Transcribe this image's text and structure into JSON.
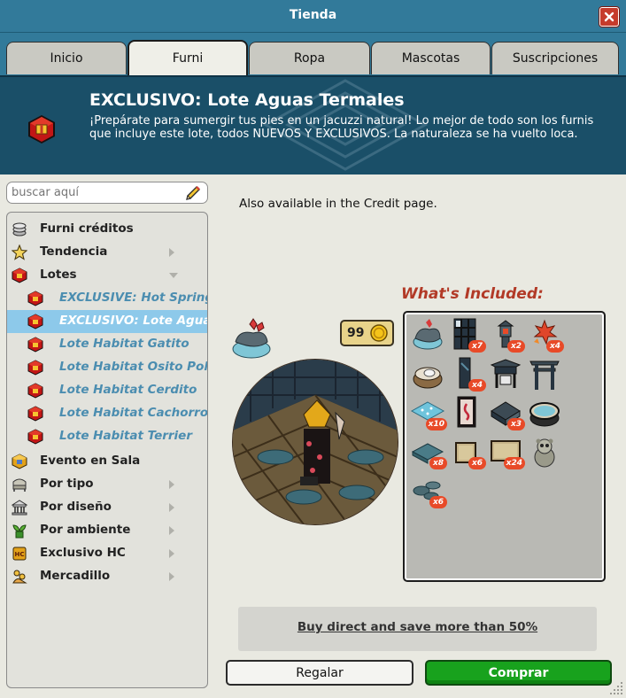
{
  "window": {
    "title": "Tienda"
  },
  "tabs": [
    {
      "label": "Inicio",
      "active": false
    },
    {
      "label": "Furni",
      "active": true
    },
    {
      "label": "Ropa",
      "active": false
    },
    {
      "label": "Mascotas",
      "active": false
    },
    {
      "label": "Suscripciones",
      "active": false
    }
  ],
  "banner": {
    "title": "EXCLUSIVO: Lote Aguas Termales",
    "description": "¡Prepárate para sumergir tus pies en un jacuzzi natural! Lo mejor de todo son los furnis que incluye este lote, todos NUEVOS Y EXCLUSIVOS. La naturaleza se ha vuelto loca."
  },
  "search": {
    "placeholder": "buscar aquí",
    "value": ""
  },
  "sidebar": {
    "items": [
      {
        "label": "Furni créditos",
        "icon": "coins-icon"
      },
      {
        "label": "Tendencia",
        "icon": "star-icon",
        "arrow": "right"
      },
      {
        "label": "Lotes",
        "icon": "bundle-cube-icon",
        "arrow": "down"
      },
      {
        "label": "EXCLUSIVE: Hot Spring",
        "icon": "bundle-cube-icon",
        "sub": true
      },
      {
        "label": "EXCLUSIVO: Lote Aguas",
        "icon": "bundle-cube-icon",
        "sub": true,
        "selected": true
      },
      {
        "label": "Lote Habitat Gatito",
        "icon": "bundle-cube-icon",
        "sub": true
      },
      {
        "label": "Lote Habitat Osito Pola",
        "icon": "bundle-cube-icon",
        "sub": true
      },
      {
        "label": "Lote Habitat Cerdito",
        "icon": "bundle-cube-icon",
        "sub": true
      },
      {
        "label": "Lote Habitat Cachorro",
        "icon": "bundle-cube-icon",
        "sub": true
      },
      {
        "label": "Lote Habitat Terrier",
        "icon": "bundle-cube-icon",
        "sub": true
      },
      {
        "label": "Evento en Sala",
        "icon": "event-cube-icon"
      },
      {
        "label": "Por tipo",
        "icon": "chair-icon",
        "arrow": "right"
      },
      {
        "label": "Por diseño",
        "icon": "building-icon",
        "arrow": "right"
      },
      {
        "label": "Por ambiente",
        "icon": "plant-icon",
        "arrow": "right"
      },
      {
        "label": "Exclusivo HC",
        "icon": "hc-icon",
        "arrow": "right"
      },
      {
        "label": "Mercadillo",
        "icon": "marketplace-icon",
        "arrow": "right"
      }
    ]
  },
  "product": {
    "notice": "Also available in the Credit page.",
    "price": "99",
    "included_title": "What's Included:",
    "included": [
      {
        "icon": "rock-pool-icon",
        "qty": ""
      },
      {
        "icon": "shoji-window-icon",
        "qty": "x7"
      },
      {
        "icon": "stone-lantern-icon",
        "qty": "x2"
      },
      {
        "icon": "maple-leaves-icon",
        "qty": "x4"
      },
      {
        "icon": "hot-tub-icon",
        "qty": ""
      },
      {
        "icon": "wall-panel-icon",
        "qty": "x4"
      },
      {
        "icon": "shrine-gate-icon",
        "qty": ""
      },
      {
        "icon": "torii-icon",
        "qty": ""
      },
      {
        "icon": "water-tile-icon",
        "qty": "x10"
      },
      {
        "icon": "paper-lamp-icon",
        "qty": ""
      },
      {
        "icon": "roof-tile-icon",
        "qty": "x3"
      },
      {
        "icon": "wooden-tub-icon",
        "qty": ""
      },
      {
        "icon": "cushion-icon",
        "qty": "x8"
      },
      {
        "icon": "tatami-small-icon",
        "qty": "x6"
      },
      {
        "icon": "tatami-large-icon",
        "qty": "x24"
      },
      {
        "icon": "raccoon-statue-icon",
        "qty": ""
      },
      {
        "icon": "stepping-stones-icon",
        "qty": "x6"
      }
    ]
  },
  "actions": {
    "buy_direct": "Buy direct and save more than 50%",
    "gift": "Regalar",
    "buy": "Comprar"
  },
  "colors": {
    "titlebar": "#327a9a",
    "banner": "#1a4f68",
    "accent_red": "#b23a27",
    "buy_green": "#18a21d",
    "selected_row": "#8dc9ea"
  }
}
